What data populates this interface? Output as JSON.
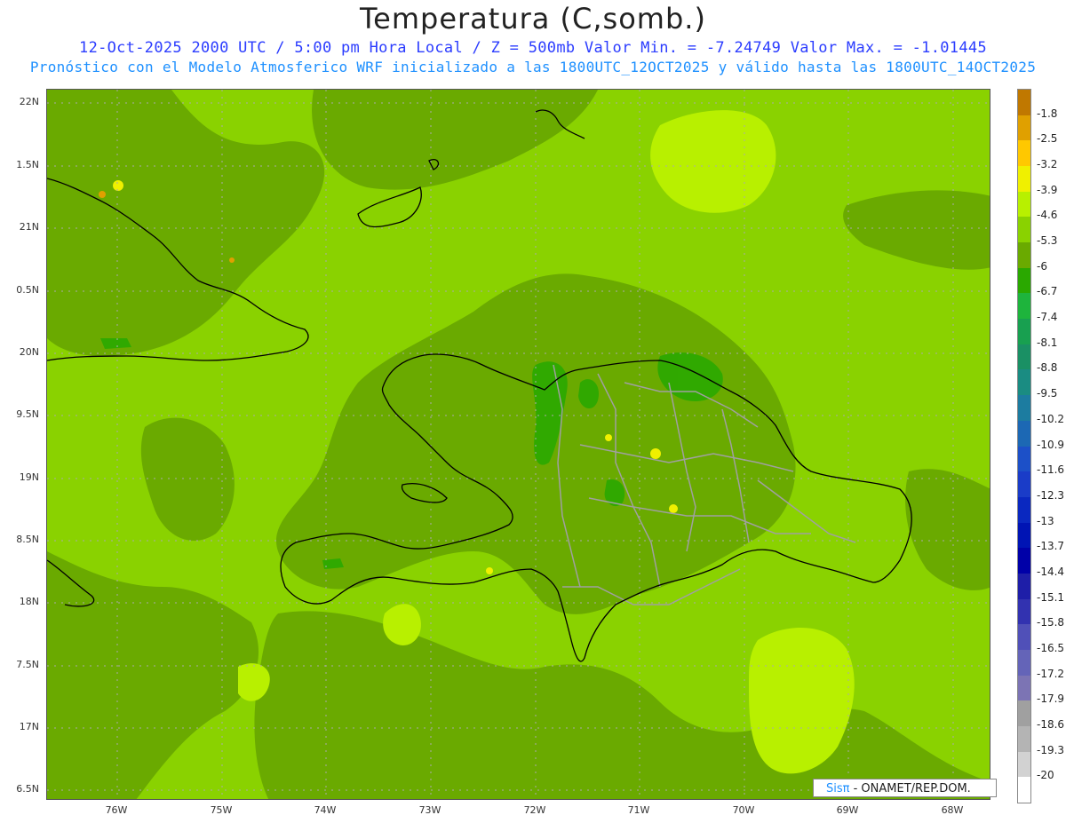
{
  "header": {
    "title": "Temperatura (C,somb.)",
    "line1": "12-Oct-2025  2000 UTC / 5:00 pm Hora Local / Z = 500mb  Valor Min. = -7.24749  Valor Max. = -1.01445",
    "line2": "Pronóstico con el Modelo Atmosferico WRF inicializado a las 1800UTC_12OCT2025 y válido hasta las  1800UTC_14OCT2025"
  },
  "axes": {
    "lat_labels": [
      "22N",
      "1.5N",
      "21N",
      "0.5N",
      "20N",
      "9.5N",
      "19N",
      "8.5N",
      "18N",
      "7.5N",
      "17N",
      "6.5N"
    ],
    "lon_labels": [
      "76W",
      "75W",
      "74W",
      "73W",
      "72W",
      "71W",
      "70W",
      "69W",
      "68W"
    ]
  },
  "legend": {
    "labels": [
      "-1.8",
      "-2.5",
      "-3.2",
      "-3.9",
      "-4.6",
      "-5.3",
      "-6",
      "-6.7",
      "-7.4",
      "-8.1",
      "-8.8",
      "-9.5",
      "-10.2",
      "-10.9",
      "-11.6",
      "-12.3",
      "-13",
      "-13.7",
      "-14.4",
      "-15.1",
      "-15.8",
      "-16.5",
      "-17.2",
      "-17.9",
      "-18.6",
      "-19.3",
      "-20"
    ],
    "colors": [
      "#c07800",
      "#e0a000",
      "#ffc800",
      "#f0f000",
      "#b8f000",
      "#8ad200",
      "#6aaa00",
      "#2aa800",
      "#1eb43c",
      "#18a050",
      "#1a9064",
      "#1a8c82",
      "#1c7ca0",
      "#1c68b4",
      "#1c50c8",
      "#1a3cc8",
      "#0a28c0",
      "#0014b4",
      "#0000a8",
      "#1e1ea8",
      "#3232b0",
      "#5050b8",
      "#6464b8",
      "#7c74b4",
      "#a0a0a0",
      "#b4b4b4",
      "#d2d2d2",
      "#ffffff"
    ]
  },
  "credit": {
    "sis": "Sisπ",
    "rest": " - ONAMET/REP.DOM."
  }
}
